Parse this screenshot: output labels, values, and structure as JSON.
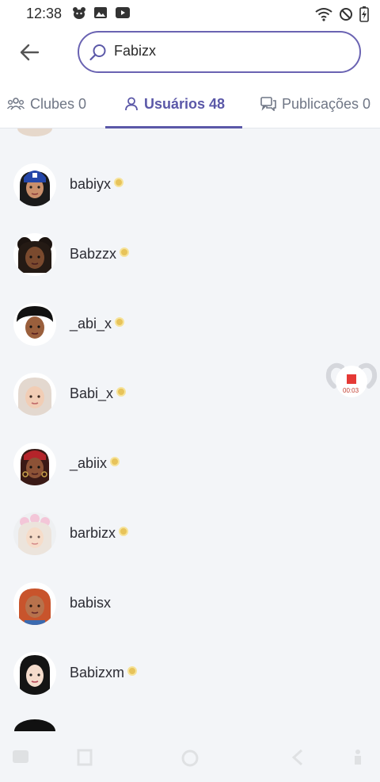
{
  "status_bar": {
    "time": "12:38",
    "left_icons": [
      "bear-icon",
      "image-icon",
      "youtube-icon"
    ],
    "right_icons": [
      "wifi-icon",
      "do-not-disturb-icon",
      "battery-icon"
    ]
  },
  "header": {
    "back_icon": "arrow-left-icon",
    "search": {
      "icon": "search-icon",
      "value": "Fabizx"
    }
  },
  "tabs": [
    {
      "label": "Clubes 0",
      "icon": "clubs-icon",
      "active": false
    },
    {
      "label": "Usuários 48",
      "icon": "user-icon",
      "active": true
    },
    {
      "label": "Publicações 0",
      "icon": "chat-icon",
      "active": false
    }
  ],
  "users": [
    {
      "name": "babiyx",
      "verified": true
    },
    {
      "name": "Babzzx",
      "verified": true
    },
    {
      "name": "_abi_x",
      "verified": true
    },
    {
      "name": "Babi_x",
      "verified": true
    },
    {
      "name": "_abiix",
      "verified": true
    },
    {
      "name": "barbizx",
      "verified": true
    },
    {
      "name": "babisx",
      "verified": false
    },
    {
      "name": "Babizxm",
      "verified": true
    }
  ],
  "recorder": {
    "time": "00:03"
  },
  "colors": {
    "accent": "#5b58a8",
    "search_border": "#6a63b2",
    "badge": "#e7c35a",
    "background": "#f3f5f8"
  }
}
